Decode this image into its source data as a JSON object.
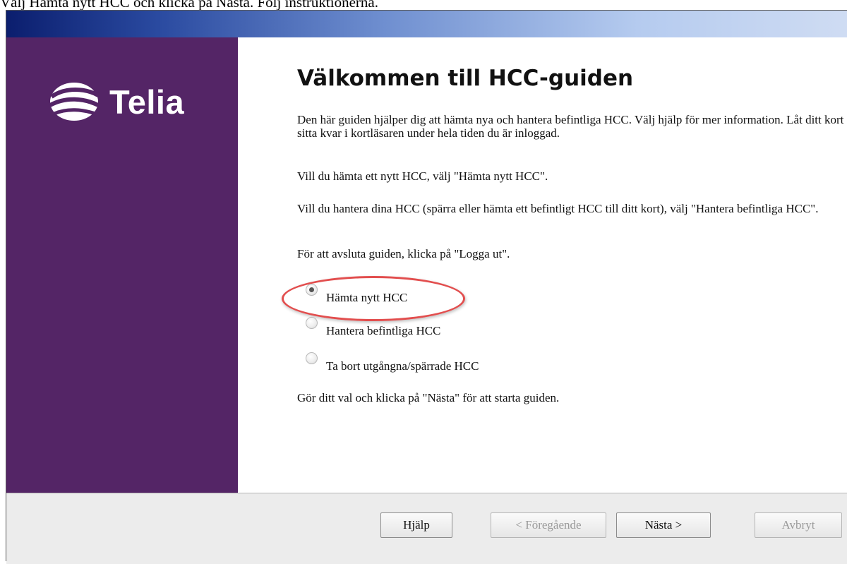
{
  "instruction": "Välj Hämta nytt HCC och klicka på Nästa. Följ instruktionerna.",
  "brand": {
    "name": "Telia",
    "color": "#542566",
    "logo_icon": "telia-pebble-icon"
  },
  "heading": "Välkommen till HCC-guiden",
  "paragraphs": {
    "intro": "Den här guiden hjälper dig att hämta nya och hantera befintliga HCC. Välj hjälp för mer information. Låt ditt kort sitta kvar i kortläsaren under hela tiden du är inloggad.",
    "fetch": "Vill du hämta ett nytt HCC, välj \"Hämta nytt HCC\".",
    "manage": "Vill du hantera dina HCC (spärra eller hämta ett befintligt HCC till ditt kort), välj \"Hantera befintliga HCC\".",
    "logout": "För att avsluta guiden, klicka på \"Logga ut\".",
    "start": "Gör ditt val och klicka på \"Nästa\" för att starta guiden."
  },
  "options": [
    {
      "label": "Hämta nytt HCC",
      "selected": true
    },
    {
      "label": "Hantera befintliga HCC",
      "selected": false
    },
    {
      "label": "Ta bort utgångna/spärrade HCC",
      "selected": false
    }
  ],
  "buttons": {
    "help": "Hjälp",
    "previous": "< Föregående",
    "next": "Nästa >",
    "cancel": "Avbryt"
  },
  "highlight_color": "#e24e4e"
}
